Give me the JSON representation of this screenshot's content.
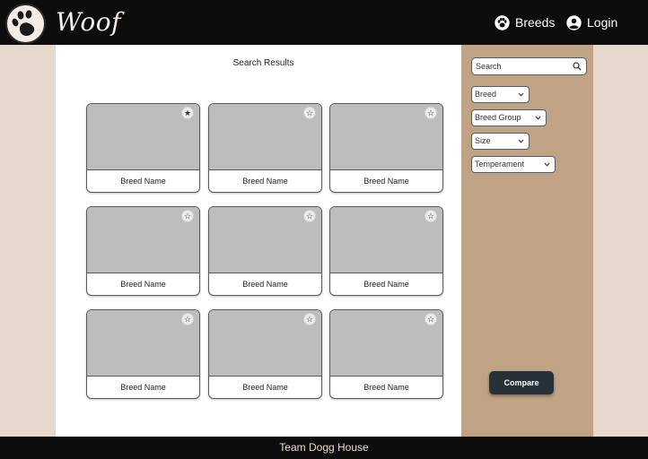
{
  "header": {
    "brand": "Woof",
    "nav": {
      "breeds": "Breeds",
      "login": "Login"
    }
  },
  "main": {
    "title": "Search Results",
    "cards": [
      {
        "label": "Breed Name",
        "favorited": true
      },
      {
        "label": "Breed Name",
        "favorited": false
      },
      {
        "label": "Breed Name",
        "favorited": false
      },
      {
        "label": "Breed Name",
        "favorited": false
      },
      {
        "label": "Breed Name",
        "favorited": false
      },
      {
        "label": "Breed Name",
        "favorited": false
      },
      {
        "label": "Breed Name",
        "favorited": false
      },
      {
        "label": "Breed Name",
        "favorited": false
      },
      {
        "label": "Breed Name",
        "favorited": false
      }
    ]
  },
  "sidebar": {
    "search_value": "Search",
    "filters": {
      "breed": "Breed",
      "breed_group": "Breed Group",
      "size": "Size",
      "temperament": "Temperament"
    },
    "compare_label": "Compare"
  },
  "footer": {
    "text": "Team Dogg House"
  },
  "colors": {
    "header_bg": "#0d0d0d",
    "page_bg": "#e6d8cc",
    "sidebar_bg": "#c0a284",
    "card_image": "#bdbdbd",
    "compare_bg": "#27313a"
  }
}
